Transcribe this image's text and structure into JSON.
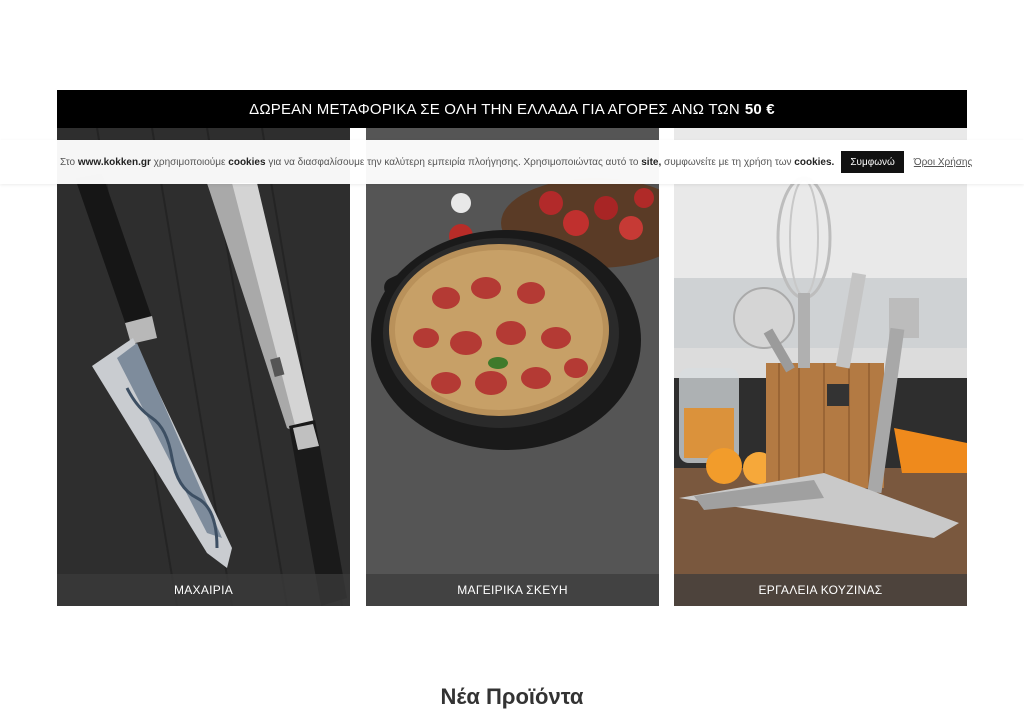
{
  "promo": {
    "text": "ΔΩΡΕΑΝ ΜΕΤΑΦΟΡΙΚΑ ΣΕ ΟΛΗ ΤΗΝ ΕΛΛΑΔΑ ΓΙΑ ΑΓΟΡΕΣ ΑΝΩ ΤΩΝ",
    "amount": "50 €"
  },
  "cookie": {
    "prefix": "Στο",
    "site": "www.kokken.gr",
    "we_use": "χρησιμοποιούμε",
    "cookies": "cookies",
    "middle": "για να διασφαλίσουμε την καλύτερη εμπειρία πλοήγησης. Χρησιμοποιώντας αυτό το",
    "site_word": "site,",
    "agree_text": "συμφωνείτε με τη χρήση των",
    "cookies_end": "cookies.",
    "accept_label": "Συμφωνώ",
    "terms_label": "Όροι Χρήσης"
  },
  "categories": [
    {
      "label": "ΜΑΧΑΙΡΙΑ",
      "image": "knives-photo"
    },
    {
      "label": "ΜΑΓΕΙΡΙΚΑ ΣΚΕΥΗ",
      "image": "cookware-photo"
    },
    {
      "label": "ΕΡΓΑΛΕΙΑ ΚΟΥΖΙΝΑΣ",
      "image": "kitchen-tools-photo"
    }
  ],
  "section": {
    "title": "Νέα Προϊόντα"
  },
  "colors": {
    "promo_bg": "#000000",
    "caption_bg": "#3c3c3c",
    "accept_bg": "#111111"
  }
}
